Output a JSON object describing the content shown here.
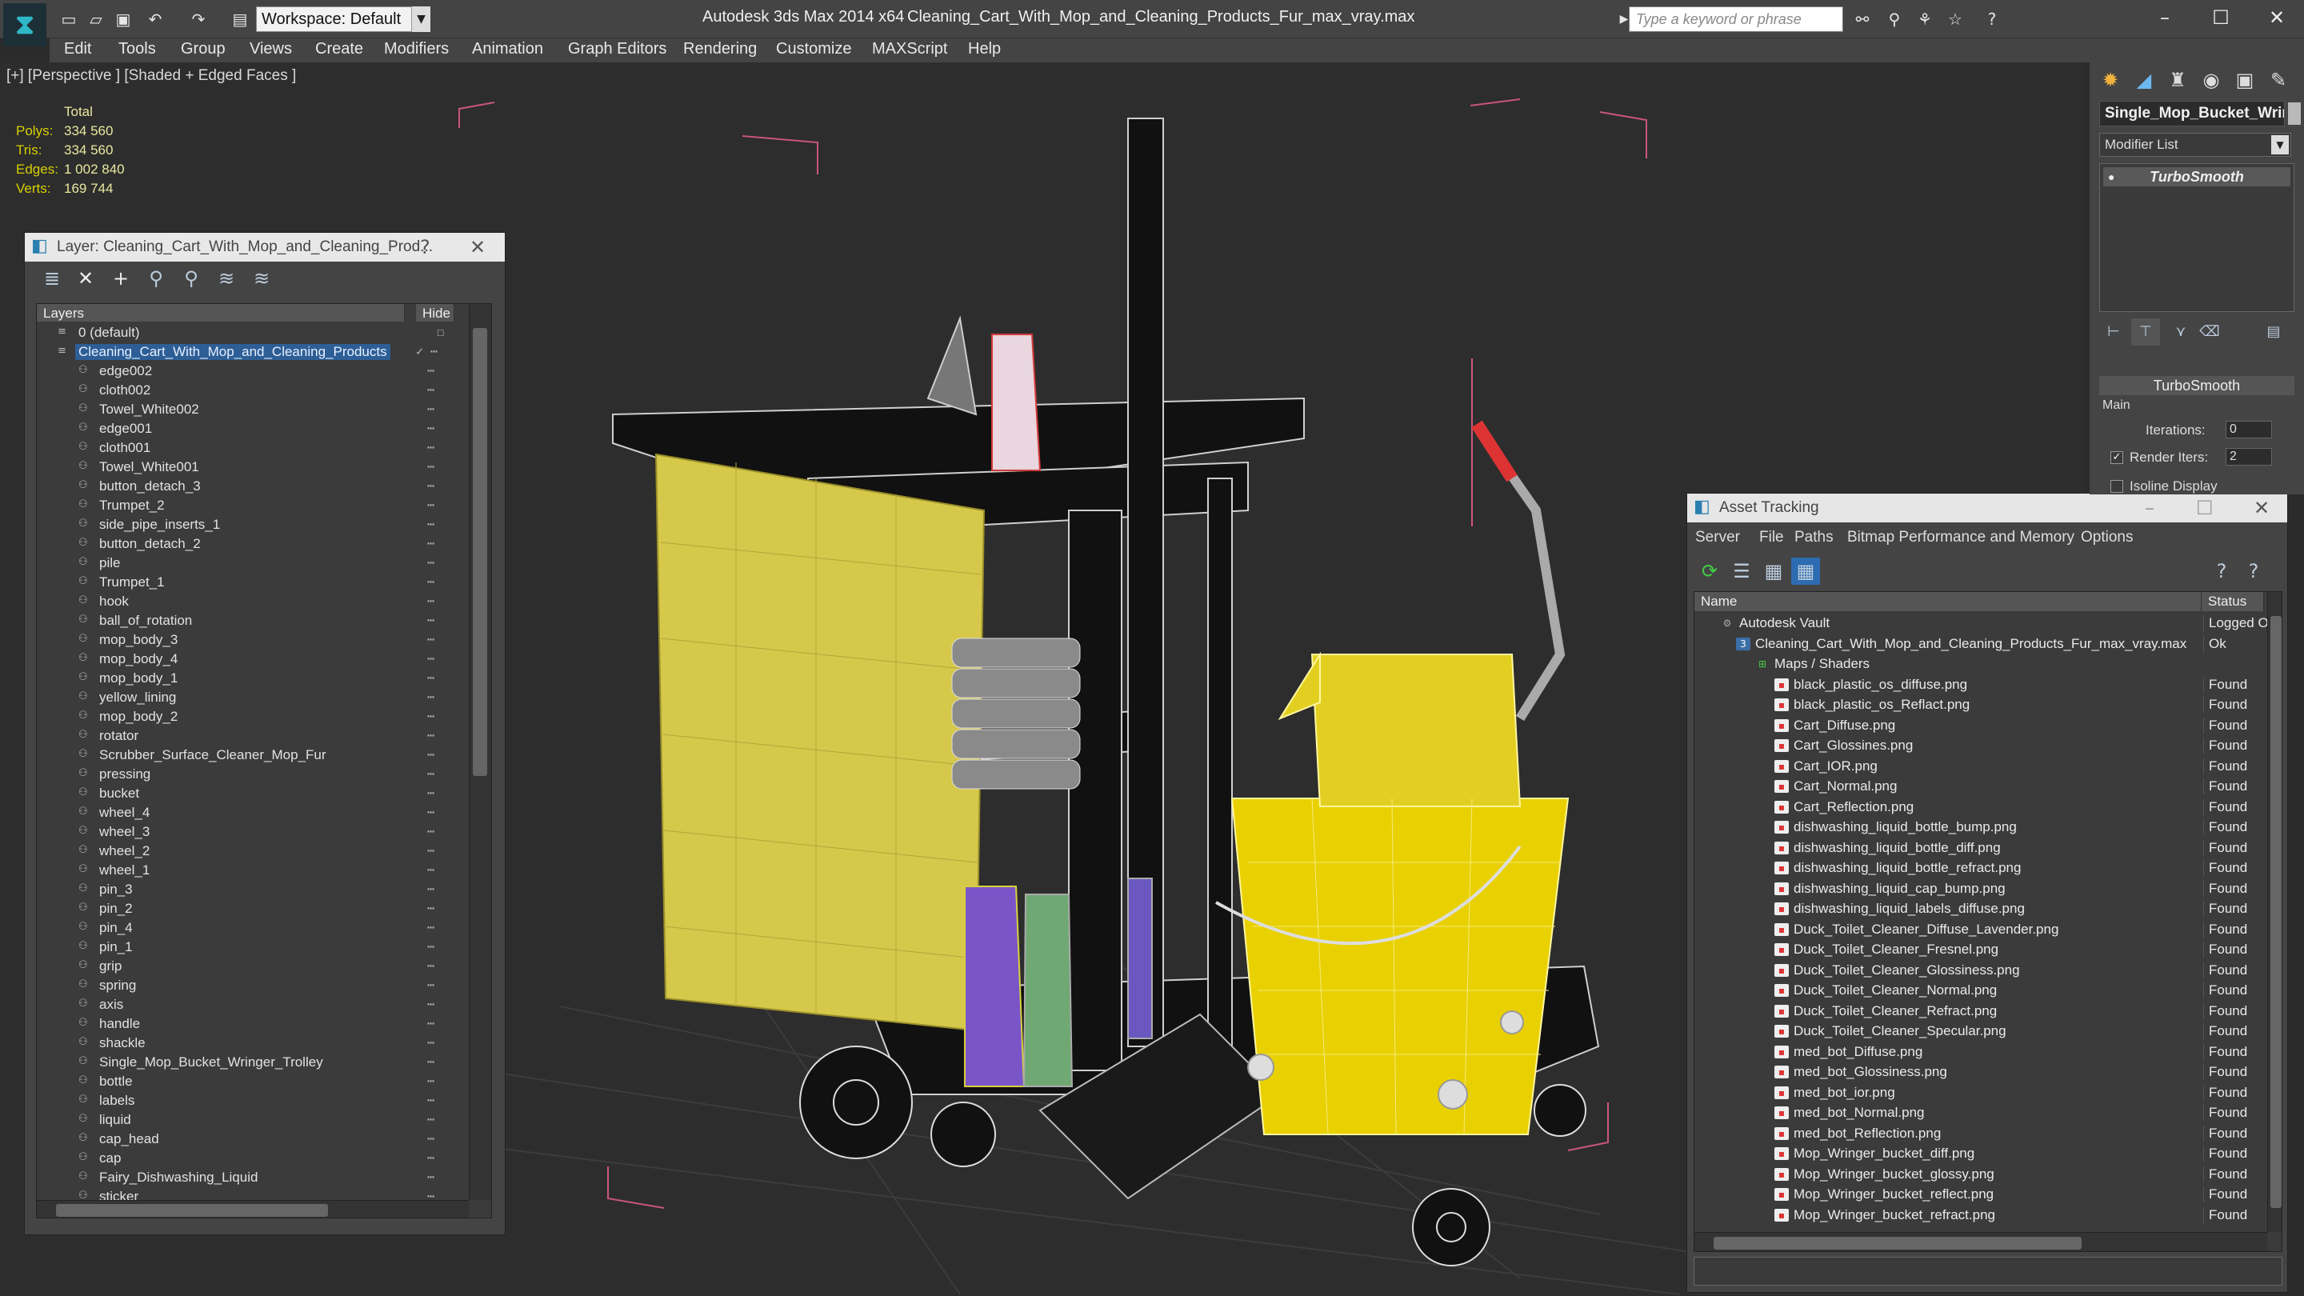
{
  "app": {
    "title": "Autodesk 3ds Max  2014 x64",
    "file": "Cleaning_Cart_With_Mop_and_Cleaning_Products_Fur_max_vray.max",
    "workspace": "Workspace: Default",
    "search_placeholder": "Type a keyword or phrase"
  },
  "menu": [
    "Edit",
    "Tools",
    "Group",
    "Views",
    "Create",
    "Modifiers",
    "Animation",
    "Graph Editors",
    "Rendering",
    "Customize",
    "MAXScript",
    "Help"
  ],
  "viewport": {
    "label": "[+] [Perspective ] [Shaded + Edged Faces ]",
    "stats": {
      "header": "Total",
      "rows": [
        {
          "k": "Polys:",
          "v": "334 560"
        },
        {
          "k": "Tris:",
          "v": "334 560"
        },
        {
          "k": "Edges:",
          "v": "1 002 840"
        },
        {
          "k": "Verts:",
          "v": "169 744"
        }
      ]
    }
  },
  "layer_panel": {
    "title": "Layer: Cleaning_Cart_With_Mop_and_Cleaning_Prod...",
    "help": "?",
    "close": "✕",
    "col_layers": "Layers",
    "col_hide": "Hide",
    "layers": [
      {
        "name": "0 (default)",
        "level": 0
      },
      {
        "name": "Cleaning_Cart_With_Mop_and_Cleaning_Products",
        "level": 0,
        "selected": true
      },
      {
        "name": "edge002",
        "level": 1
      },
      {
        "name": "cloth002",
        "level": 1
      },
      {
        "name": "Towel_White002",
        "level": 1
      },
      {
        "name": "edge001",
        "level": 1
      },
      {
        "name": "cloth001",
        "level": 1
      },
      {
        "name": "Towel_White001",
        "level": 1
      },
      {
        "name": "button_detach_3",
        "level": 1
      },
      {
        "name": "Trumpet_2",
        "level": 1
      },
      {
        "name": "side_pipe_inserts_1",
        "level": 1
      },
      {
        "name": "button_detach_2",
        "level": 1
      },
      {
        "name": "pile",
        "level": 1
      },
      {
        "name": "Trumpet_1",
        "level": 1
      },
      {
        "name": "hook",
        "level": 1
      },
      {
        "name": "ball_of_rotation",
        "level": 1
      },
      {
        "name": "mop_body_3",
        "level": 1
      },
      {
        "name": "mop_body_4",
        "level": 1
      },
      {
        "name": "mop_body_1",
        "level": 1
      },
      {
        "name": "yellow_lining",
        "level": 1
      },
      {
        "name": "mop_body_2",
        "level": 1
      },
      {
        "name": "rotator",
        "level": 1
      },
      {
        "name": "Scrubber_Surface_Cleaner_Mop_Fur",
        "level": 1
      },
      {
        "name": "pressing",
        "level": 1
      },
      {
        "name": "bucket",
        "level": 1
      },
      {
        "name": "wheel_4",
        "level": 1
      },
      {
        "name": "wheel_3",
        "level": 1
      },
      {
        "name": "wheel_2",
        "level": 1
      },
      {
        "name": "wheel_1",
        "level": 1
      },
      {
        "name": "pin_3",
        "level": 1
      },
      {
        "name": "pin_2",
        "level": 1
      },
      {
        "name": "pin_4",
        "level": 1
      },
      {
        "name": "pin_1",
        "level": 1
      },
      {
        "name": "grip",
        "level": 1
      },
      {
        "name": "spring",
        "level": 1
      },
      {
        "name": "axis",
        "level": 1
      },
      {
        "name": "handle",
        "level": 1
      },
      {
        "name": "shackle",
        "level": 1
      },
      {
        "name": "Single_Mop_Bucket_Wringer_Trolley",
        "level": 1
      },
      {
        "name": "bottle",
        "level": 1
      },
      {
        "name": "labels",
        "level": 1
      },
      {
        "name": "liquid",
        "level": 1
      },
      {
        "name": "cap_head",
        "level": 1
      },
      {
        "name": "cap",
        "level": 1
      },
      {
        "name": "Fairy_Dishwashing_Liquid",
        "level": 1
      },
      {
        "name": "sticker",
        "level": 1
      }
    ]
  },
  "asset_panel": {
    "title": "Asset Tracking",
    "menu": [
      "Server",
      "File",
      "Paths",
      "Bitmap Performance and Memory",
      "Options"
    ],
    "col_name": "Name",
    "col_status": "Status",
    "rows": [
      {
        "name": "Autodesk Vault",
        "status": "Logged O",
        "indent": 1,
        "icon": "vault"
      },
      {
        "name": "Cleaning_Cart_With_Mop_and_Cleaning_Products_Fur_max_vray.max",
        "status": "Ok",
        "indent": 2,
        "icon": "max"
      },
      {
        "name": "Maps / Shaders",
        "status": "",
        "indent": 3,
        "icon": "maps"
      },
      {
        "name": "black_plastic_os_diffuse.png",
        "status": "Found",
        "indent": 4,
        "icon": "png"
      },
      {
        "name": "black_plastic_os_Reflact.png",
        "status": "Found",
        "indent": 4,
        "icon": "png"
      },
      {
        "name": "Cart_Diffuse.png",
        "status": "Found",
        "indent": 4,
        "icon": "png"
      },
      {
        "name": "Cart_Glossines.png",
        "status": "Found",
        "indent": 4,
        "icon": "png"
      },
      {
        "name": "Cart_IOR.png",
        "status": "Found",
        "indent": 4,
        "icon": "png"
      },
      {
        "name": "Cart_Normal.png",
        "status": "Found",
        "indent": 4,
        "icon": "png"
      },
      {
        "name": "Cart_Reflection.png",
        "status": "Found",
        "indent": 4,
        "icon": "png"
      },
      {
        "name": "dishwashing_liquid_bottle_bump.png",
        "status": "Found",
        "indent": 4,
        "icon": "png"
      },
      {
        "name": "dishwashing_liquid_bottle_diff.png",
        "status": "Found",
        "indent": 4,
        "icon": "png"
      },
      {
        "name": "dishwashing_liquid_bottle_refract.png",
        "status": "Found",
        "indent": 4,
        "icon": "png"
      },
      {
        "name": "dishwashing_liquid_cap_bump.png",
        "status": "Found",
        "indent": 4,
        "icon": "png"
      },
      {
        "name": "dishwashing_liquid_labels_diffuse.png",
        "status": "Found",
        "indent": 4,
        "icon": "png"
      },
      {
        "name": "Duck_Toilet_Cleaner_Diffuse_Lavender.png",
        "status": "Found",
        "indent": 4,
        "icon": "png"
      },
      {
        "name": "Duck_Toilet_Cleaner_Fresnel.png",
        "status": "Found",
        "indent": 4,
        "icon": "png"
      },
      {
        "name": "Duck_Toilet_Cleaner_Glossiness.png",
        "status": "Found",
        "indent": 4,
        "icon": "png"
      },
      {
        "name": "Duck_Toilet_Cleaner_Normal.png",
        "status": "Found",
        "indent": 4,
        "icon": "png"
      },
      {
        "name": "Duck_Toilet_Cleaner_Refract.png",
        "status": "Found",
        "indent": 4,
        "icon": "png"
      },
      {
        "name": "Duck_Toilet_Cleaner_Specular.png",
        "status": "Found",
        "indent": 4,
        "icon": "png"
      },
      {
        "name": "med_bot_Diffuse.png",
        "status": "Found",
        "indent": 4,
        "icon": "png"
      },
      {
        "name": "med_bot_Glossiness.png",
        "status": "Found",
        "indent": 4,
        "icon": "png"
      },
      {
        "name": "med_bot_ior.png",
        "status": "Found",
        "indent": 4,
        "icon": "png"
      },
      {
        "name": "med_bot_Normal.png",
        "status": "Found",
        "indent": 4,
        "icon": "png"
      },
      {
        "name": "med_bot_Reflection.png",
        "status": "Found",
        "indent": 4,
        "icon": "png"
      },
      {
        "name": "Mop_Wringer_bucket_diff.png",
        "status": "Found",
        "indent": 4,
        "icon": "png"
      },
      {
        "name": "Mop_Wringer_bucket_glossy.png",
        "status": "Found",
        "indent": 4,
        "icon": "png"
      },
      {
        "name": "Mop_Wringer_bucket_reflect.png",
        "status": "Found",
        "indent": 4,
        "icon": "png"
      },
      {
        "name": "Mop_Wringer_bucket_refract.png",
        "status": "Found",
        "indent": 4,
        "icon": "png"
      }
    ]
  },
  "command_panel": {
    "object_name": "Single_Mop_Bucket_Wrir",
    "modifier_list": "Modifier List",
    "stack_item": "TurboSmooth",
    "rollout_title": "TurboSmooth",
    "group_main": "Main",
    "iterations_label": "Iterations:",
    "iterations_value": "0",
    "render_iters_label": "Render Iters:",
    "render_iters_value": "2",
    "isoline_label": "Isoline Display"
  }
}
